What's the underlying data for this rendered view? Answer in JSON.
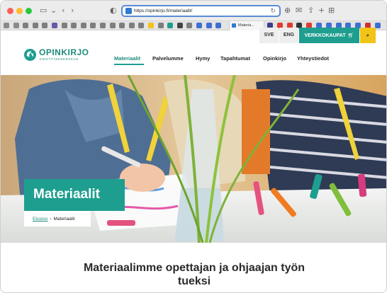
{
  "browser": {
    "url": "https://opinkirjo.fi/materiaalit/",
    "active_tab_title": "Materia...",
    "tab_favicon_colors": [
      "#8a8a8a",
      "#8a8a8a",
      "#7e7e7e",
      "#7e7e7e",
      "#7e7e7e",
      "#6b56a8",
      "#7e7e7e",
      "#7e7e7e",
      "#7e7e7e",
      "#7e7e7e",
      "#7e7e7e",
      "#7e7e7e",
      "#7e7e7e",
      "#7e7e7e",
      "#7e7e7e",
      "#f2c418",
      "#7e7e7e",
      "#1e9e8f",
      "#444444",
      "#7e7e7e",
      "#3f6fd1",
      "#3f6fd1",
      "#3f6fd1"
    ],
    "right_favicon_colors": [
      "#3c3c8a",
      "#e03a2e",
      "#e03a2e",
      "#333333",
      "#e03a2e",
      "#3f6fd1",
      "#3f6fd1",
      "#3f6fd1",
      "#3f6fd1",
      "#3f6fd1",
      "#d03030",
      "#3f6fd1"
    ]
  },
  "header": {
    "lang_sve": "SVE",
    "lang_eng": "ENG",
    "shop_label": "VERKKOKAUPAT",
    "shop_icon": "cart-icon",
    "search_icon": "search-icon",
    "logo_name": "OPINKIRJO",
    "logo_sub": "KEHITTÄMISKESKUS",
    "nav": {
      "materiaalit": "Materiaalit",
      "palvelumme": "Palvelumme",
      "hymy": "Hymy",
      "tapahtumat": "Tapahtumat",
      "opinkirjo": "Opinkirjo",
      "yhteystiedot": "Yhteystiedot"
    }
  },
  "hero": {
    "title": "Materiaalit",
    "breadcrumb_home": "Etusivu",
    "breadcrumb_sep": "›",
    "breadcrumb_current": "Materiaalit"
  },
  "content": {
    "heading": "Materiaalimme opettajan ja ohjaajan työn tueksi"
  },
  "colors": {
    "brand_teal": "#1e9e8f",
    "accent_yellow": "#f2c418"
  }
}
